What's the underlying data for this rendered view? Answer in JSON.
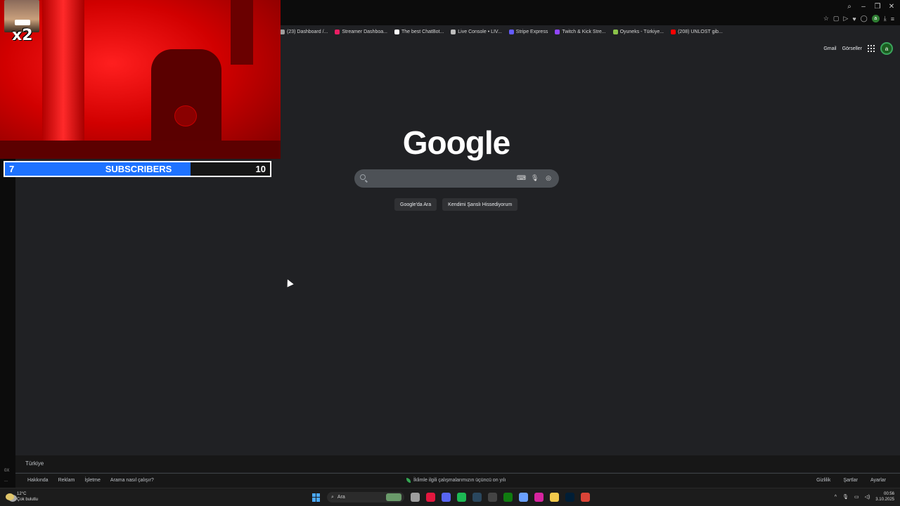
{
  "browser": {
    "bookmarks": [
      {
        "label": "(23) Dashboard /...",
        "color": "#9e9e9e"
      },
      {
        "label": "Streamer Dashboa...",
        "color": "#e91e63"
      },
      {
        "label": "The best ChatBot...",
        "color": "#ffffff"
      },
      {
        "label": "Live Console • LIV...",
        "color": "#bdbdbd"
      },
      {
        "label": "Stripe Express",
        "color": "#635bff"
      },
      {
        "label": "Twitch & Kick Stre...",
        "color": "#9146ff"
      },
      {
        "label": "Oyuneks - Türkiye...",
        "color": "#8bc34a"
      },
      {
        "label": "(208) UNLOST gib...",
        "color": "#ff0000"
      }
    ]
  },
  "google": {
    "logo": "Google",
    "header_links": {
      "gmail": "Gmail",
      "images": "Görseller"
    },
    "avatar_letter": "a",
    "search_button": "Google'da Ara",
    "lucky_button": "Kendimi Şanslı Hissediyorum",
    "country": "Türkiye",
    "footer_left": [
      "Hakkında",
      "Reklam",
      "İşletme",
      "Arama nasıl çalışır?"
    ],
    "footer_center": "İklimle ilgili çalışmalarımızın üçüncü on yılı",
    "footer_right": [
      "Gizlilik",
      "Şartlar",
      "Ayarlar"
    ]
  },
  "overlay": {
    "multiplier": "x2",
    "subscribers": {
      "current": "7",
      "label": "SUBSCRIBERS",
      "goal": "10",
      "progress": 0.7
    }
  },
  "taskbar": {
    "weather_temp": "12°C",
    "weather_desc": "Çok bulutlu",
    "search_label": "Ara",
    "time": "00:56",
    "date": "3.10.2025",
    "left_strip_labels": [
      "0X",
      "..."
    ],
    "apps": [
      {
        "name": "file-explorer-icon",
        "color": "#9e9e9e"
      },
      {
        "name": "opera-icon",
        "color": "#e3173e"
      },
      {
        "name": "discord-icon",
        "color": "#5865f2"
      },
      {
        "name": "spotify-icon",
        "color": "#1db954"
      },
      {
        "name": "steam-icon",
        "color": "#2a475e"
      },
      {
        "name": "epic-games-icon",
        "color": "#444444"
      },
      {
        "name": "xbox-icon",
        "color": "#107c10"
      },
      {
        "name": "copilot-icon",
        "color": "#6aa0ff"
      },
      {
        "name": "instagram-icon",
        "color": "#d6249f"
      },
      {
        "name": "folder-icon",
        "color": "#f2c94c"
      },
      {
        "name": "photoshop-icon",
        "color": "#001e36"
      },
      {
        "name": "chrome-icon",
        "color": "#db4437"
      }
    ]
  },
  "colors": {
    "subscriber_fill": "#1e72ff",
    "page_bg": "#202124"
  }
}
